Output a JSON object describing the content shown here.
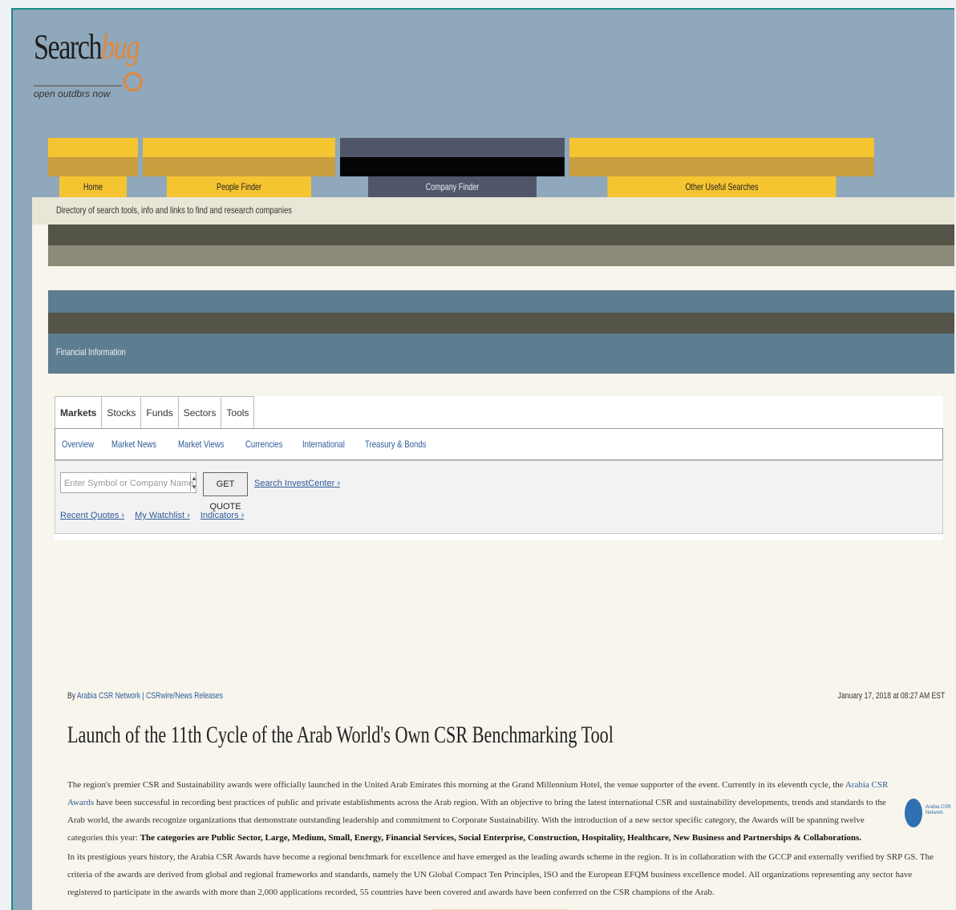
{
  "logo": {
    "word1": "Search",
    "word2": "bug",
    "tagline": "open outdbrs now"
  },
  "nav": [
    {
      "label": "Home",
      "active": false
    },
    {
      "label": "People Finder",
      "active": false
    },
    {
      "label": "Company Finder",
      "active": true
    },
    {
      "label": "Other Useful Searches",
      "active": false
    }
  ],
  "description": "Directory of search tools, info and links to find and research companies",
  "financial_header": "Financial Information",
  "finance_tabs": [
    "Markets",
    "Stocks",
    "Funds",
    "Sectors",
    "Tools"
  ],
  "finance_links": [
    "Overview",
    "Market News",
    "Market Views",
    "Currencies",
    "International",
    "Treasury & Bonds"
  ],
  "quote": {
    "placeholder": "Enter Symbol or Company Name",
    "button": "GET QUOTE",
    "link": "Search InvestCenter ›",
    "links": [
      "Recent Quotes ›",
      "My Watchlist ›",
      "Indicators ›"
    ]
  },
  "article": {
    "by": "By",
    "source": "Arabia CSR Network | CSRwire/News Releases",
    "date": "January 17, 2018 at 08:27 AM EST",
    "headline": "Launch of the 11th Cycle of the Arab World's Own CSR Benchmarking Tool",
    "p1_text": "The region's premier CSR and Sustainability awards were officially launched in the United Arab Emirates this morning at the Grand Millennium Hotel, the venue supporter of the event. Currently in its eleventh cycle, the ",
    "p1_link": "Arabia CSR Awards",
    "p1_text2": " have been successful in recording best practices of public and private establishments across the Arab region. With an objective to bring the latest international CSR and sustainability developments, trends and standards to the Arab world, the awards recognize organizations that demonstrate outstanding leadership and commitment to Corporate Sustainability. With the introduction of a new sector specific category, the Awards will be spanning twelve categories this year: ",
    "p1_bold": "The categories are Public Sector, Large, Medium, Small, Energy, Financial Services, Social Enterprise, Construction, Hospitality, Healthcare, New Business and Partnerships & Collaborations.",
    "p2_text": "In its prestigious years history, the Arabia CSR Awards have become a regional benchmark for excellence and have emerged as the leading awards scheme in the region. It is in collaboration with the GCCP and externally verified by SRP GS. The criteria of the awards are derived from global and regional frameworks and standards, namely the UN Global Compact Ten Principles, ISO and the European EFQM business excellence model. All organizations representing any sector have registered to participate in the awards with more than 2,000 applications recorded, 55 countries have been covered and awards have been conferred on the CSR champions of the Arab.",
    "badge_text": "Arabia CSR Network"
  }
}
